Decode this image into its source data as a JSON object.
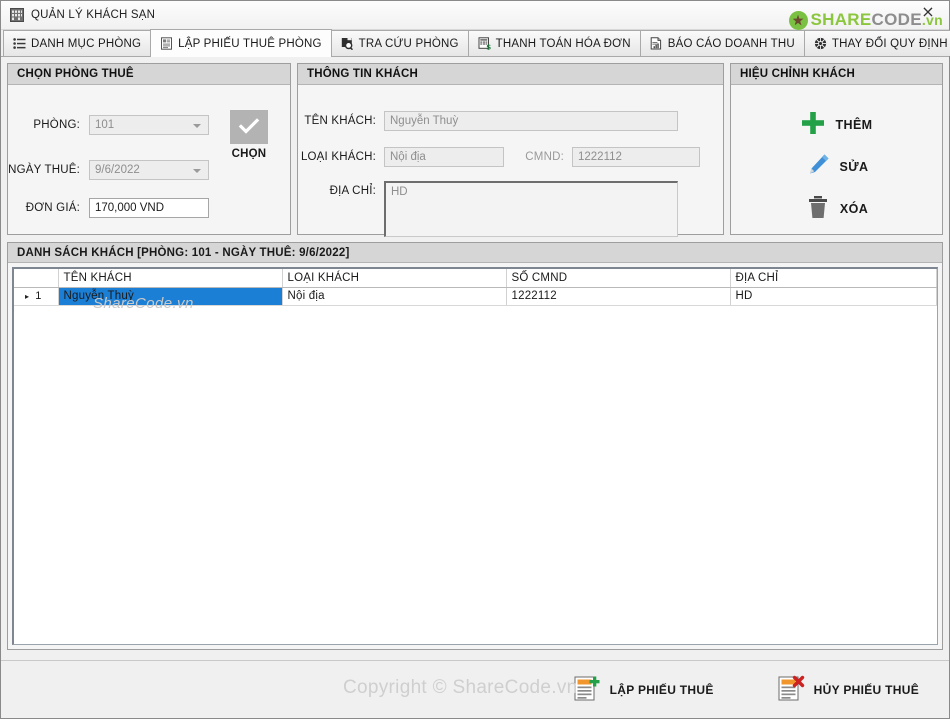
{
  "window": {
    "title": "QUẢN LÝ KHÁCH SẠN",
    "title_icon": "grid-building-icon",
    "close_label": "×"
  },
  "logo": {
    "part1": "SHARE",
    "part2": "CODE",
    "part3": ".vn"
  },
  "tabs": [
    {
      "label": "DANH MỤC PHÒNG",
      "icon": "list-icon",
      "active": false
    },
    {
      "label": "LẬP PHIẾU THUÊ PHÒNG",
      "icon": "document-icon",
      "active": true
    },
    {
      "label": "TRA CỨU PHÒNG",
      "icon": "search-icon",
      "active": false
    },
    {
      "label": "THANH TOÁN HÓA ĐƠN",
      "icon": "invoice-icon",
      "active": false
    },
    {
      "label": "BÁO CÁO DOANH THU",
      "icon": "report-icon",
      "active": false
    },
    {
      "label": "THAY ĐỔI QUY ĐỊNH",
      "icon": "gear-icon",
      "active": false
    }
  ],
  "room_panel": {
    "title": "CHỌN PHÒNG THUÊ",
    "room_label": "PHÒNG:",
    "room_value": "101",
    "date_label": "NGÀY THUÊ:",
    "date_value": "9/6/2022",
    "price_label": "ĐƠN GIÁ:",
    "price_value": "170,000 VND",
    "select_label": "CHỌN",
    "select_icon": "check-icon"
  },
  "guest_panel": {
    "title": "THÔNG TIN KHÁCH",
    "name_label": "TÊN KHÁCH:",
    "name_value": "Nguyễn Thuỳ",
    "type_label": "LOẠI KHÁCH:",
    "type_value": "Nội địa",
    "id_label": "CMND:",
    "id_value": "1222112",
    "address_label": "ĐỊA CHỈ:",
    "address_value": "HD"
  },
  "edit_panel": {
    "title": "HIỆU CHỈNH KHÁCH",
    "add_label": "THÊM",
    "add_icon": "plus-icon",
    "edit_label": "SỬA",
    "edit_icon": "pencil-icon",
    "delete_label": "XÓA",
    "delete_icon": "trash-icon"
  },
  "grid": {
    "title": "DANH SÁCH KHÁCH [PHÒNG: 101 - NGÀY THUÊ: 9/6/2022]",
    "columns": [
      "",
      "TÊN KHÁCH",
      "LOẠI KHÁCH",
      "SỐ CMND",
      "ĐỊA CHỈ"
    ],
    "rows": [
      {
        "index": "1",
        "marker": "▸",
        "name": "Nguyễn Thuỳ",
        "type": "Nội địa",
        "id": "1222112",
        "address": "HD",
        "selected": true
      }
    ]
  },
  "footer": {
    "watermark": "Copyright © ShareCode.vn",
    "watermark_grid": "ShareCode.vn",
    "create_label": "LẬP PHIẾU THUÊ",
    "create_icon": "document-add-icon",
    "cancel_label": "HỦY PHIẾU THUÊ",
    "cancel_icon": "document-delete-icon"
  },
  "colors": {
    "accent_green": "#8cc63e",
    "selection_blue": "#1c7fd6",
    "pencil_blue": "#3f90d6",
    "delete_red": "#cc2222",
    "panel_header": "#d6d6d6"
  }
}
